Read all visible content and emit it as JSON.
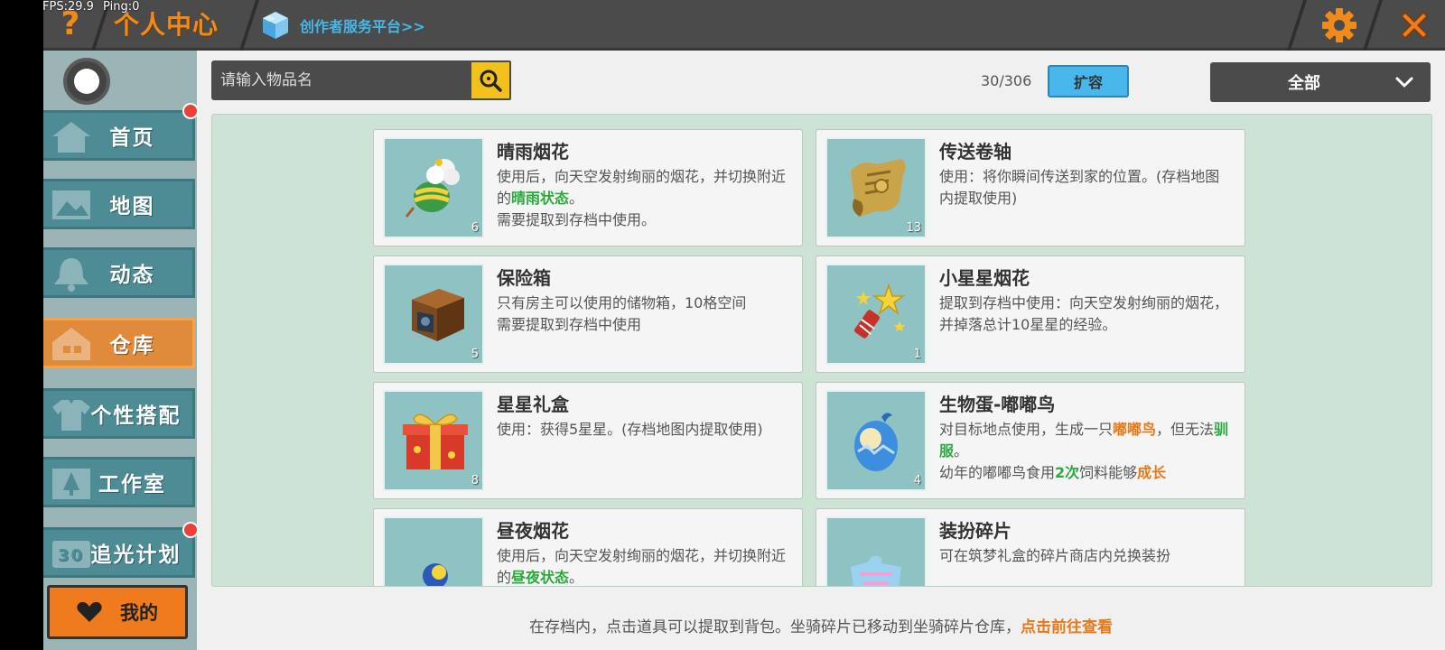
{
  "debug": {
    "fps": "FPS:29.9",
    "ping": "Ping:0"
  },
  "header": {
    "help_label": "?",
    "title": "个人中心",
    "creator_link": "创作者服务平台>>"
  },
  "sidebar": {
    "items": [
      {
        "label": "首页",
        "icon": "home-icon",
        "badge": true
      },
      {
        "label": "地图",
        "icon": "map-icon",
        "badge": false
      },
      {
        "label": "动态",
        "icon": "bell-icon",
        "badge": false
      },
      {
        "label": "仓库",
        "icon": "house-icon",
        "badge": false,
        "active": true
      },
      {
        "label": "个性搭配",
        "icon": "shirt-icon",
        "badge": false
      },
      {
        "label": "工作室",
        "icon": "tree-icon",
        "badge": false
      },
      {
        "label": "追光计划",
        "icon": "light-icon",
        "badge": true
      }
    ],
    "mine_label": "我的"
  },
  "toolbar": {
    "search_placeholder": "请输入物品名",
    "capacity": "30/306",
    "expand_label": "扩容",
    "filter_value": "全部"
  },
  "items": [
    {
      "name": "晴雨烟花",
      "count": "6",
      "icon": "firework-ball-icon",
      "desc": [
        {
          "t": "使用后，向天空发射绚丽的烟花，并切换附近的"
        },
        {
          "t": "晴雨状态",
          "c": "green"
        },
        {
          "t": "。"
        },
        {
          "t": "需要提取到存档中使用。",
          "br": true
        }
      ]
    },
    {
      "name": "传送卷轴",
      "count": "13",
      "icon": "scroll-icon",
      "desc": [
        {
          "t": "使用：将你瞬间传送到家的位置。(存档地图内提取使用)"
        }
      ]
    },
    {
      "name": "保险箱",
      "count": "5",
      "icon": "safe-box-icon",
      "desc": [
        {
          "t": "只有房主可以使用的储物箱，10格空间"
        },
        {
          "t": "需要提取到存档中使用",
          "br": true
        }
      ]
    },
    {
      "name": "小星星烟花",
      "count": "1",
      "icon": "star-firework-icon",
      "desc": [
        {
          "t": "提取到存档中使用：向天空发射绚丽的烟花，并掉落总计10星星的经验。"
        }
      ]
    },
    {
      "name": "星星礼盒",
      "count": "8",
      "icon": "gift-box-icon",
      "desc": [
        {
          "t": "使用：获得5星星。(存档地图内提取使用)"
        }
      ]
    },
    {
      "name": "生物蛋-嘟嘟鸟",
      "count": "4",
      "icon": "egg-icon",
      "desc": [
        {
          "t": "对目标地点使用，生成一只"
        },
        {
          "t": "嘟嘟鸟",
          "c": "orange"
        },
        {
          "t": "，但无法"
        },
        {
          "t": "驯服",
          "c": "green"
        },
        {
          "t": "。"
        },
        {
          "t": "幼年的嘟嘟鸟食用",
          "br": true
        },
        {
          "t": "2次",
          "c": "green"
        },
        {
          "t": "饲料能够"
        },
        {
          "t": "成长",
          "c": "orange"
        }
      ]
    },
    {
      "name": "昼夜烟花",
      "count": "",
      "icon": "day-night-firework-icon",
      "desc": [
        {
          "t": "使用后，向天空发射绚丽的烟花，并切换附近的"
        },
        {
          "t": "昼夜状态",
          "c": "green"
        },
        {
          "t": "。"
        }
      ]
    },
    {
      "name": "装扮碎片",
      "count": "",
      "icon": "puzzle-piece-icon",
      "desc": [
        {
          "t": "可在筑梦礼盒的碎片商店内兑换装扮"
        }
      ]
    }
  ],
  "footer": {
    "note": "在存档内，点击道具可以提取到背包。坐骑碎片已移动到坐骑碎片仓库，",
    "link": "点击前往查看"
  },
  "colors": {
    "accent_orange": "#f08a1a",
    "nav_teal": "#4d8b95",
    "highlight_green": "#2aaa3c",
    "highlight_orange": "#e8791a",
    "link_blue": "#45b7e8"
  }
}
